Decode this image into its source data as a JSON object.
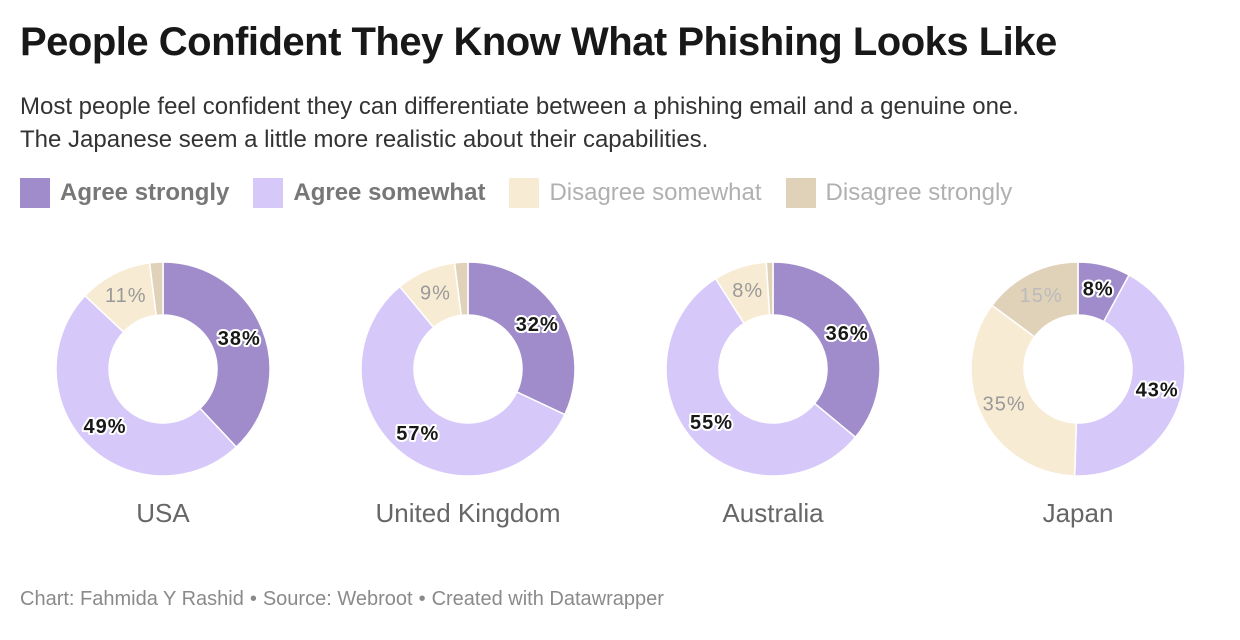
{
  "title": "People Confident They Know What Phishing Looks Like",
  "subtitle": {
    "line1": "Most people feel confident they can differentiate between a phishing email and a genuine one.",
    "line2": "The Japanese seem a little more realistic about their capabilities."
  },
  "legend": [
    {
      "label": "Agree strongly",
      "color": "#a08ccb",
      "active": true
    },
    {
      "label": "Agree somewhat",
      "color": "#d7c8fa",
      "active": true
    },
    {
      "label": "Disagree somewhat",
      "color": "#f8ebd3",
      "active": false
    },
    {
      "label": "Disagree strongly",
      "color": "#e0d2b8",
      "active": false
    }
  ],
  "chart_data": {
    "type": "pie",
    "variant": "donut",
    "categories": [
      "Agree strongly",
      "Agree somewhat",
      "Disagree somewhat",
      "Disagree strongly"
    ],
    "colors": [
      "#a08ccb",
      "#d7c8fa",
      "#f8ebd3",
      "#e0d2b8"
    ],
    "panels": [
      {
        "name": "USA",
        "values": [
          38,
          49,
          11,
          2
        ],
        "labels": [
          "38%",
          "49%",
          "11%",
          ""
        ]
      },
      {
        "name": "United Kingdom",
        "values": [
          32,
          57,
          9,
          2
        ],
        "labels": [
          "32%",
          "57%",
          "9%",
          ""
        ]
      },
      {
        "name": "Australia",
        "values": [
          36,
          55,
          8,
          1
        ],
        "labels": [
          "36%",
          "55%",
          "8%",
          ""
        ]
      },
      {
        "name": "Japan",
        "values": [
          8,
          43,
          35,
          15
        ],
        "labels": [
          "8%",
          "43%",
          "35%",
          "15%"
        ]
      }
    ]
  },
  "footer": {
    "chart_by": "Chart: Fahmida Y Rashid",
    "source": "Source: Webroot",
    "tool": "Created with Datawrapper",
    "separator": "•"
  }
}
